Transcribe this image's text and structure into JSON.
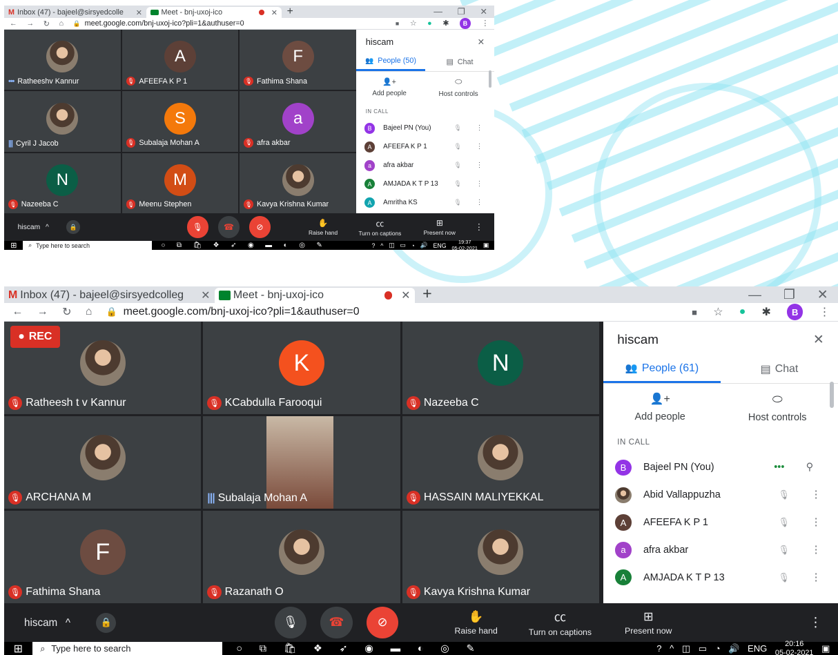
{
  "colors": {
    "accent": "#1a73e8",
    "danger": "#d93025",
    "bg_dark": "#202124",
    "tile": "#3c4043"
  },
  "top": {
    "tabs": [
      {
        "label": "Inbox (47) - bajeel@sirsyedcolle",
        "icon": "gmail-icon"
      },
      {
        "label": "Meet - bnj-uxoj-ico",
        "icon": "meet-icon"
      }
    ],
    "url": "meet.google.com/bnj-uxoj-ico?pli=1&authuser=0",
    "profile": "B",
    "tiles": [
      {
        "name": "Ratheeshv Kannur",
        "type": "photo",
        "indicator": "dots"
      },
      {
        "name": "AFEEFA K P 1",
        "letter": "A",
        "color": "#5d4037",
        "indicator": "mute"
      },
      {
        "name": "Fathima Shana",
        "letter": "F",
        "color": "#6d4c41",
        "indicator": "mute"
      },
      {
        "name": "Cyril J Jacob",
        "type": "photo",
        "indicator": "talk"
      },
      {
        "name": "Subalaja Mohan A",
        "letter": "S",
        "color": "#f4790b",
        "indicator": "mute"
      },
      {
        "name": "afra akbar",
        "letter": "a",
        "color": "#a142c9",
        "indicator": "mute"
      },
      {
        "name": "Nazeeba C",
        "letter": "N",
        "color": "#0b5e46",
        "indicator": "mute"
      },
      {
        "name": "Meenu Stephen",
        "letter": "M",
        "color": "#d24d15",
        "indicator": "mute"
      },
      {
        "name": "Kavya Krishna Kumar",
        "type": "photo",
        "indicator": "mute"
      }
    ],
    "panel": {
      "title": "hiscam",
      "people_tab": "People (50)",
      "chat_tab": "Chat",
      "add_people": "Add people",
      "host_controls": "Host controls",
      "in_call": "IN CALL",
      "people": [
        {
          "name": "Bajeel PN (You)",
          "letter": "B",
          "color": "#9334e6"
        },
        {
          "name": "AFEEFA K P 1",
          "letter": "A",
          "color": "#5d4037"
        },
        {
          "name": "afra akbar",
          "letter": "a",
          "color": "#a142c9"
        },
        {
          "name": "AMJADA K T P 13",
          "letter": "A",
          "color": "#188038"
        },
        {
          "name": "Amritha KS",
          "letter": "A",
          "color": "#12a4af"
        }
      ]
    },
    "bar": {
      "meeting": "hiscam",
      "raise_hand": "Raise hand",
      "captions": "Turn on captions",
      "present": "Present now"
    },
    "taskbar": {
      "search": "Type here to search",
      "lang": "ENG",
      "time": "19:37",
      "date": "05-02-2021"
    }
  },
  "bottom": {
    "tabs": [
      {
        "label": "Inbox (47) - bajeel@sirsyedcolleg",
        "icon": "gmail-icon"
      },
      {
        "label": "Meet - bnj-uxoj-ico",
        "icon": "meet-icon"
      }
    ],
    "url": "meet.google.com/bnj-uxoj-ico?pli=1&authuser=0",
    "profile": "B",
    "rec": "REC",
    "tiles": [
      {
        "name": "Ratheesh t v Kannur",
        "type": "photo",
        "indicator": "mute"
      },
      {
        "name": "KCabdulla Farooqui",
        "letter": "K",
        "color": "#f4511e",
        "indicator": "mute"
      },
      {
        "name": "Nazeeba C",
        "letter": "N",
        "color": "#0b5e46",
        "indicator": "mute"
      },
      {
        "name": "ARCHANA M",
        "type": "photo",
        "indicator": "mute"
      },
      {
        "name": "Subalaja Mohan A",
        "type": "video",
        "indicator": "talk"
      },
      {
        "name": "HASSAIN MALIYEKKAL",
        "type": "photo",
        "indicator": "mute"
      },
      {
        "name": "Fathima Shana",
        "letter": "F",
        "color": "#6d4c41",
        "indicator": "mute"
      },
      {
        "name": "Razanath O",
        "type": "photo",
        "indicator": "mute"
      },
      {
        "name": "Kavya Krishna Kumar",
        "type": "photo",
        "indicator": "mute"
      }
    ],
    "panel": {
      "title": "hiscam",
      "people_tab": "People (61)",
      "chat_tab": "Chat",
      "add_people": "Add people",
      "host_controls": "Host controls",
      "in_call": "IN CALL",
      "people": [
        {
          "name": "Bajeel PN (You)",
          "letter": "B",
          "color": "#9334e6",
          "you": true
        },
        {
          "name": "Abid Vallappuzha",
          "type": "photo",
          "color": "#c8a27a"
        },
        {
          "name": "AFEEFA K P 1",
          "letter": "A",
          "color": "#5d4037"
        },
        {
          "name": "afra akbar",
          "letter": "a",
          "color": "#a142c9"
        },
        {
          "name": "AMJADA K T P 13",
          "letter": "A",
          "color": "#188038"
        }
      ]
    },
    "bar": {
      "meeting": "hiscam",
      "raise_hand": "Raise hand",
      "captions": "Turn on captions",
      "present": "Present now"
    },
    "taskbar": {
      "search": "Type here to search",
      "lang": "ENG",
      "time": "20:16",
      "date": "05-02-2021"
    }
  }
}
